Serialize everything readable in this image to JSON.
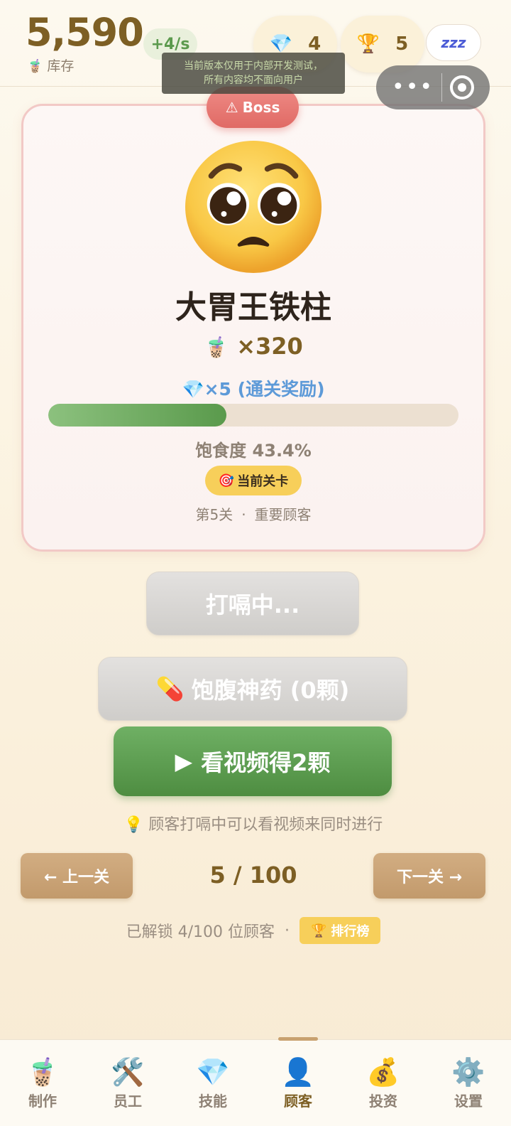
{
  "header": {
    "stock_value": "5,590",
    "stock_label": "库存",
    "stock_icon": "bubble-tea-icon",
    "rate": "+4/s",
    "gems": "4",
    "trophies": "5",
    "sleep_label": "zzz"
  },
  "toast": {
    "line1": "当前版本仅用于内部开发测试，",
    "line2": "所有内容均不面向用户"
  },
  "capsule": {
    "more": "•••"
  },
  "customer": {
    "badge": "Boss",
    "name": "大胃王铁柱",
    "requirement": "×320",
    "reward": "💎×5 (通关奖励)",
    "satiety_percent": 43.4,
    "satiety_text": "饱食度 43.4%",
    "level_badge": "当前关卡",
    "level_no": "第5关",
    "level_type": "重要顾客"
  },
  "actions": {
    "burp": "打嗝中...",
    "potion": "饱腹神药 (0颗)",
    "video": "看视频得2颗",
    "tip": "顾客打嗝中可以看视频来同时进行"
  },
  "pagination": {
    "prev": "← 上一关",
    "next": "下一关 →",
    "indicator": "5 / 100",
    "unlocked": "已解锁 4/100 位顾客",
    "leaderboard": "排行榜"
  },
  "tabs": [
    {
      "label": "制作",
      "icon": "bubble-tea-icon"
    },
    {
      "label": "员工",
      "icon": "tools-icon"
    },
    {
      "label": "技能",
      "icon": "gem-icon"
    },
    {
      "label": "顾客",
      "icon": "person-icon",
      "active": true
    },
    {
      "label": "投资",
      "icon": "money-bag-icon"
    },
    {
      "label": "设置",
      "icon": "gear-icon"
    }
  ],
  "colors": {
    "accent": "#7d5f24",
    "boss": "#e06a65",
    "progress": "#5a9a4c",
    "video": "#4e8d41",
    "gold": "#f7cf5a"
  }
}
